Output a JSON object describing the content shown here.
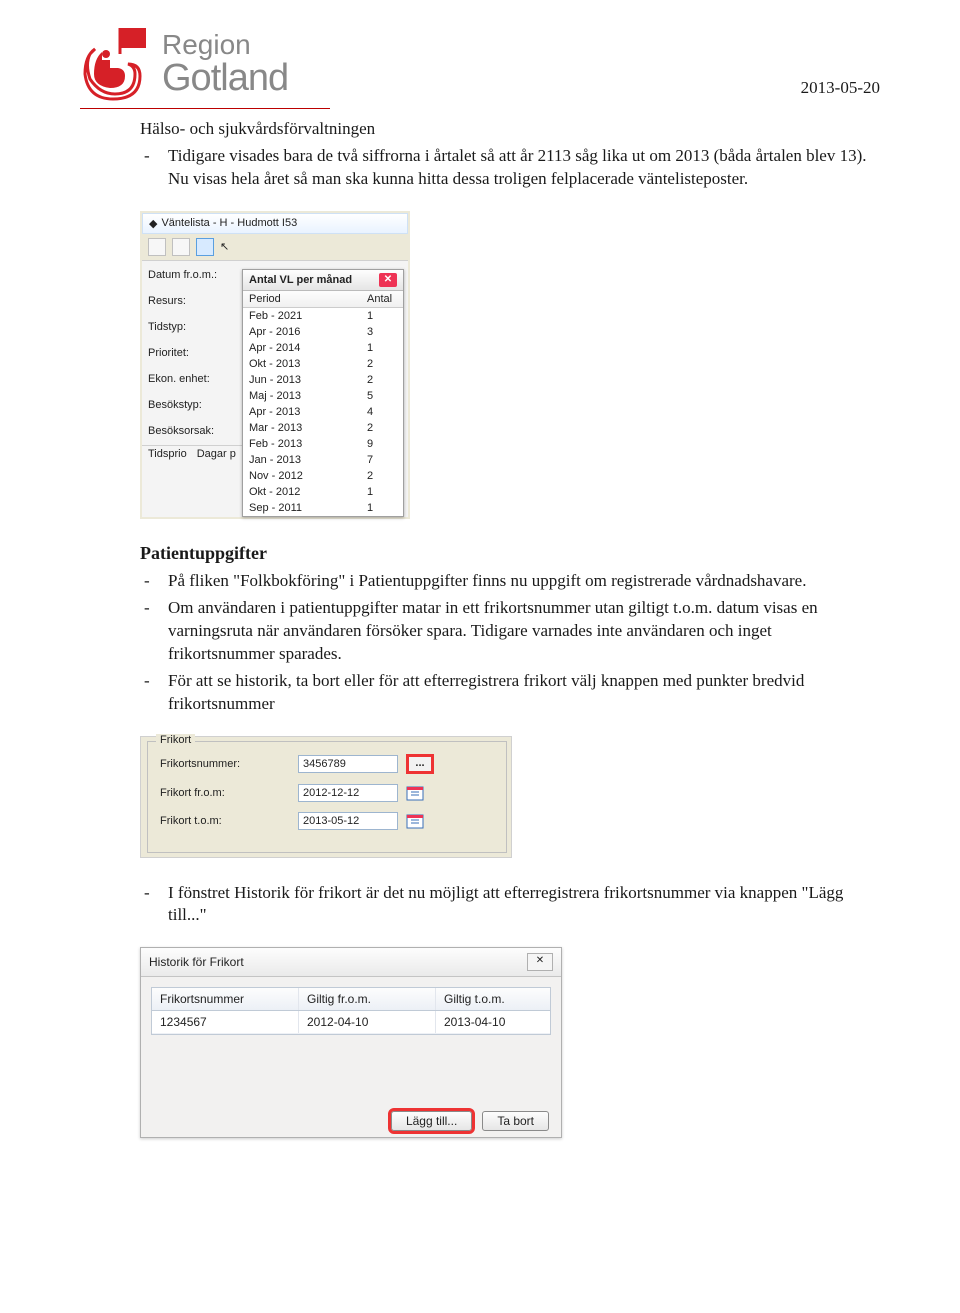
{
  "header": {
    "logo_line1": "Region",
    "logo_line2": "Gotland",
    "date": "2013-05-20"
  },
  "subheading": "Hälso- och sjukvårdsförvaltningen",
  "top_bullets": [
    "Tidigare visades bara de två siffrorna i årtalet så att år 2113 såg lika ut om 2013 (båda årtalen blev 13). Nu visas hela året så man ska kunna hitta dessa troligen felplacerade väntelisteposter."
  ],
  "shot1": {
    "title": "Väntelista - H - Hudmott I53",
    "left_labels": [
      "Datum fr.o.m.:",
      "Resurs:",
      "Tidstyp:",
      "Prioritet:",
      "Ekon. enhet:",
      "Besökstyp:",
      "Besöksorsak:"
    ],
    "bottom_labels": [
      "Tidsprio",
      "Dagar p"
    ],
    "popup_title": "Antal VL per månad",
    "popup_cols": [
      "Period",
      "Antal"
    ],
    "popup_rows": [
      [
        "Feb - 2021",
        "1"
      ],
      [
        "Apr - 2016",
        "3"
      ],
      [
        "Apr - 2014",
        "1"
      ],
      [
        "Okt - 2013",
        "2"
      ],
      [
        "Jun - 2013",
        "2"
      ],
      [
        "Maj - 2013",
        "5"
      ],
      [
        "Apr - 2013",
        "4"
      ],
      [
        "Mar - 2013",
        "2"
      ],
      [
        "Feb - 2013",
        "9"
      ],
      [
        "Jan - 2013",
        "7"
      ],
      [
        "Nov - 2012",
        "2"
      ],
      [
        "Okt - 2012",
        "1"
      ],
      [
        "Sep - 2011",
        "1"
      ]
    ]
  },
  "section2_title": "Patientuppgifter",
  "section2_bullets": [
    "På fliken \"Folkbokföring\" i Patientuppgifter finns nu uppgift om registrerade vårdnadshavare.",
    "Om användaren i patientuppgifter matar in ett frikortsnummer utan giltigt t.o.m. datum visas en varningsruta när användaren försöker spara. Tidigare varnades inte användaren och inget frikortsnummer sparades.",
    "För att se historik, ta bort eller för att efterregistrera frikort välj knappen med punkter bredvid frikortsnummer"
  ],
  "shot2": {
    "legend": "Frikort",
    "rows": [
      {
        "label": "Frikortsnummer:",
        "value": "3456789",
        "dots": true
      },
      {
        "label": "Frikort fr.o.m:",
        "value": "2012-12-12",
        "cal": true
      },
      {
        "label": "Frikort t.o.m:",
        "value": "2013-05-12",
        "cal": true
      }
    ],
    "dots_label": "..."
  },
  "section3_bullets": [
    "I fönstret Historik för frikort är det nu möjligt att efterregistrera frikortsnummer via knappen \"Lägg till...\""
  ],
  "shot3": {
    "title": "Historik för Frikort",
    "cols": [
      "Frikortsnummer",
      "Giltig fr.o.m.",
      "Giltig t.o.m."
    ],
    "rows": [
      [
        "1234567",
        "2012-04-10",
        "2013-04-10"
      ]
    ],
    "btn_add": "Lägg till...",
    "btn_remove": "Ta bort",
    "close": "✕"
  }
}
